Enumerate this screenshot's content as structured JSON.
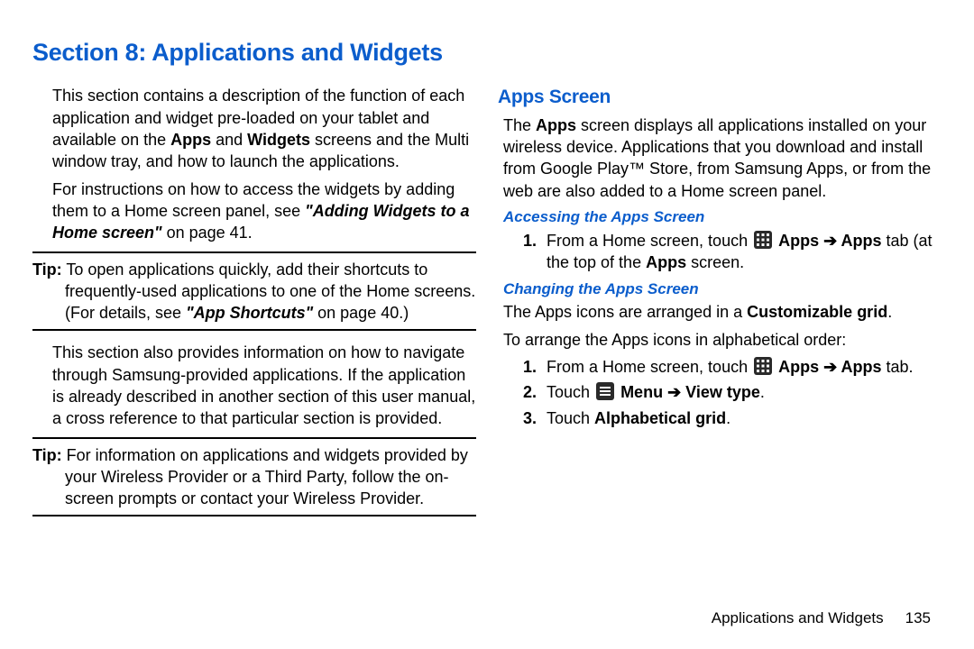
{
  "title": "Section 8: Applications and Widgets",
  "left": {
    "p1_a": "This section contains a description of the function of each application and widget pre-loaded on your tablet and available on the ",
    "p1_b1": "Apps",
    "p1_mid": " and ",
    "p1_b2": "Widgets",
    "p1_c": " screens and the Multi window tray, and how to launch the applications.",
    "p2_a": "For instructions on how to access the widgets by adding them to a Home screen panel, see ",
    "p2_ref": "\"Adding Widgets to a Home screen\"",
    "p2_b": " on page 41.",
    "tip1_label": "Tip:",
    "tip1_a": " To open applications quickly, add their shortcuts to frequently-used applications to one of the Home screens. (For details, see ",
    "tip1_ref": "\"App Shortcuts\"",
    "tip1_b": " on page 40.)",
    "p3": "This section also provides information on how to navigate through Samsung-provided applications. If the application is already described in another section of this user manual, a cross reference to that particular section is provided.",
    "tip2_label": "Tip:",
    "tip2_body": " For information on applications and widgets provided by your Wireless Provider or a Third Party, follow the on-screen prompts or contact your Wireless Provider."
  },
  "right": {
    "h2": "Apps Screen",
    "p1_a": "The ",
    "p1_b": "Apps",
    "p1_c": " screen displays all applications installed on your wireless device. Applications that you download and install from Google Play™ Store, from Samsung Apps, or from the web are also added to a Home screen panel.",
    "h3a": "Accessing the Apps Screen",
    "a1_num": "1.",
    "a1_a": "From a Home screen, touch ",
    "a1_b1": "Apps",
    "a1_arrow": " ➔ ",
    "a1_b2": "Apps",
    "a1_c": " tab (at the top of the ",
    "a1_b3": "Apps",
    "a1_d": " screen.",
    "h3b": "Changing the Apps Screen",
    "b_p1_a": "The Apps icons are arranged in a ",
    "b_p1_b": "Customizable grid",
    "b_p1_c": ".",
    "b_p2": "To arrange the Apps icons in alphabetical order:",
    "c1_num": "1.",
    "c1_a": "From a Home screen, touch ",
    "c1_b1": "Apps",
    "c1_arrow": " ➔ ",
    "c1_b2": "Apps",
    "c1_c": " tab.",
    "c2_num": "2.",
    "c2_a": "Touch ",
    "c2_b1": "Menu",
    "c2_arrow": " ➔ ",
    "c2_b2": "View type",
    "c2_c": ".",
    "c3_num": "3.",
    "c3_a": "Touch ",
    "c3_b": "Alphabetical grid",
    "c3_c": "."
  },
  "footer": {
    "section": "Applications and Widgets",
    "page": "135"
  }
}
